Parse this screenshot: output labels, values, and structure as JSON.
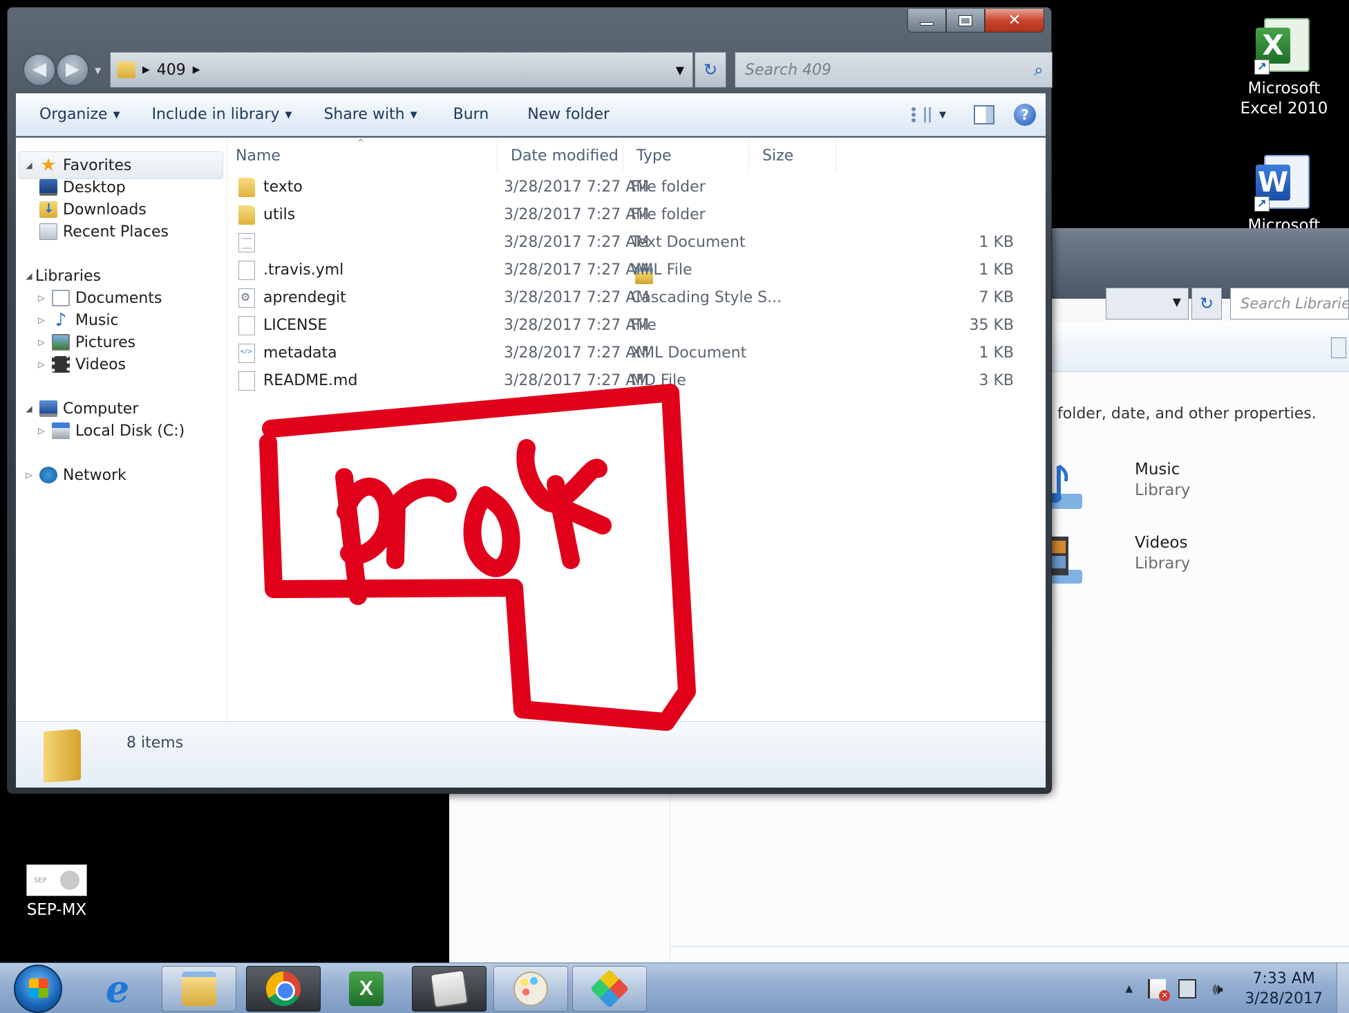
{
  "desktop": {
    "icons": [
      {
        "label_line1": "Microsoft",
        "label_line2": "Excel 2010",
        "icon": "excel-shortcut-icon",
        "glyph": "X"
      },
      {
        "label_line1": "Microsoft",
        "label_line2": "",
        "icon": "word-shortcut-icon",
        "glyph": "W"
      },
      {
        "label_line1": "SEP-MX",
        "label_line2": "",
        "icon": "sep-mx-icon"
      }
    ],
    "shortcut_arrow": "↗"
  },
  "background_window": {
    "search_placeholder": "Search Libraries",
    "description": "folder, date, and other properties.",
    "libraries": [
      {
        "name": "Music",
        "subtitle": "Library",
        "icon": "music-library-icon"
      },
      {
        "name": "Videos",
        "subtitle": "Library",
        "icon": "videos-library-icon"
      }
    ]
  },
  "window": {
    "caption": {
      "minimize": "",
      "maximize": "",
      "close": "✕"
    },
    "nav": {
      "back": "◀",
      "forward": "▶",
      "history_caret": "▼"
    },
    "address": {
      "crumb": "409",
      "separator": "▶",
      "dropdown": "▼"
    },
    "refresh_glyph": "↻",
    "search": {
      "placeholder": "Search 409",
      "icon": "⌕"
    },
    "toolbar": {
      "organize": "Organize",
      "include_in_library": "Include in library",
      "share_with": "Share with",
      "burn": "Burn",
      "new_folder": "New folder",
      "caret": "▼",
      "help": "?"
    },
    "nav_pane": {
      "favorites": {
        "label": "Favorites",
        "items": [
          "Desktop",
          "Downloads",
          "Recent Places"
        ]
      },
      "libraries": {
        "label": "Libraries",
        "items": [
          "Documents",
          "Music",
          "Pictures",
          "Videos"
        ]
      },
      "computer": {
        "label": "Computer",
        "items": [
          "Local Disk (C:)"
        ]
      },
      "network": {
        "label": "Network"
      },
      "expanded_glyph": "◢",
      "collapsed_glyph": "▷",
      "star": "★",
      "note": "♪"
    },
    "columns": {
      "name": "Name",
      "date": "Date modified",
      "type": "Type",
      "size": "Size",
      "sort_caret": "^"
    },
    "files": [
      {
        "name": "texto",
        "date": "3/28/2017 7:27 AM",
        "type": "File folder",
        "size": "",
        "icon": "folder-icon"
      },
      {
        "name": "utils",
        "date": "3/28/2017 7:27 AM",
        "type": "File folder",
        "size": "",
        "icon": "folder-icon"
      },
      {
        "name": "",
        "date": "3/28/2017 7:27 AM",
        "type": "Text Document",
        "size": "1 KB",
        "icon": "text-file-icon"
      },
      {
        "name": ".travis.yml",
        "date": "3/28/2017 7:27 AM",
        "type": "YML File",
        "size": "1 KB",
        "icon": "blank-file-icon"
      },
      {
        "name": "aprendegit",
        "date": "3/28/2017 7:27 AM",
        "type": "Cascading Style S...",
        "size": "7 KB",
        "icon": "css-file-icon"
      },
      {
        "name": "LICENSE",
        "date": "3/28/2017 7:27 AM",
        "type": "File",
        "size": "35 KB",
        "icon": "blank-file-icon"
      },
      {
        "name": "metadata",
        "date": "3/28/2017 7:27 AM",
        "type": "XML Document",
        "size": "1 KB",
        "icon": "xml-file-icon"
      },
      {
        "name": "README.md",
        "date": "3/28/2017 7:27 AM",
        "type": "MD File",
        "size": "3 KB",
        "icon": "blank-file-icon"
      }
    ],
    "status": {
      "item_count": "8 items"
    }
  },
  "annotation": {
    "color": "#e0001a",
    "text": "prof"
  },
  "taskbar": {
    "pinned": [
      "internet-explorer-icon",
      "windows-explorer-icon",
      "chrome-icon",
      "excel-icon",
      "notes-icon",
      "paint-icon",
      "git-gui-icon"
    ],
    "ie_glyph": "e",
    "excel_glyph": "X",
    "tray": {
      "show_hidden": "▲",
      "volume": "🕪",
      "time": "7:33 AM",
      "date": "3/28/2017"
    }
  }
}
